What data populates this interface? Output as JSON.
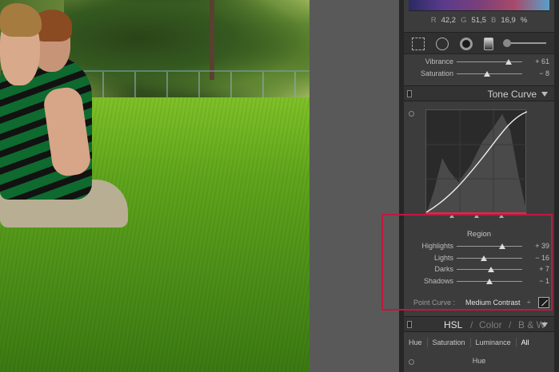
{
  "rgb_readout": {
    "r_label": "R",
    "r_value": "42,2",
    "g_label": "G",
    "g_value": "51,5",
    "b_label": "B",
    "b_value": "16,9",
    "unit": "%"
  },
  "basic_sliders": [
    {
      "label": "Vibrance",
      "value": "+ 61",
      "level": 0.79
    },
    {
      "label": "Saturation",
      "value": "− 8",
      "level": 0.46
    }
  ],
  "tone_curve": {
    "title": "Tone Curve",
    "region_label": "Region",
    "sliders": [
      {
        "label": "Highlights",
        "value": "+ 39",
        "level": 0.69
      },
      {
        "label": "Lights",
        "value": "− 16",
        "level": 0.42
      },
      {
        "label": "Darks",
        "value": "+ 7",
        "level": 0.53
      },
      {
        "label": "Shadows",
        "value": "− 1",
        "level": 0.5
      }
    ],
    "split_points": [
      0.25,
      0.5,
      0.75
    ],
    "point_curve_label": "Point Curve :",
    "point_curve_value": "Medium Contrast",
    "point_curve_arrow": "÷"
  },
  "hsl": {
    "tabs_header": [
      "HSL",
      "Color",
      "B & W"
    ],
    "separator": "/",
    "sub_tabs": [
      "Hue",
      "Saturation",
      "Luminance",
      "All"
    ],
    "sub_heading": "Hue"
  },
  "colors": {
    "accent_highlight": "#c41640",
    "panel_bg": "#3c3c3c"
  }
}
